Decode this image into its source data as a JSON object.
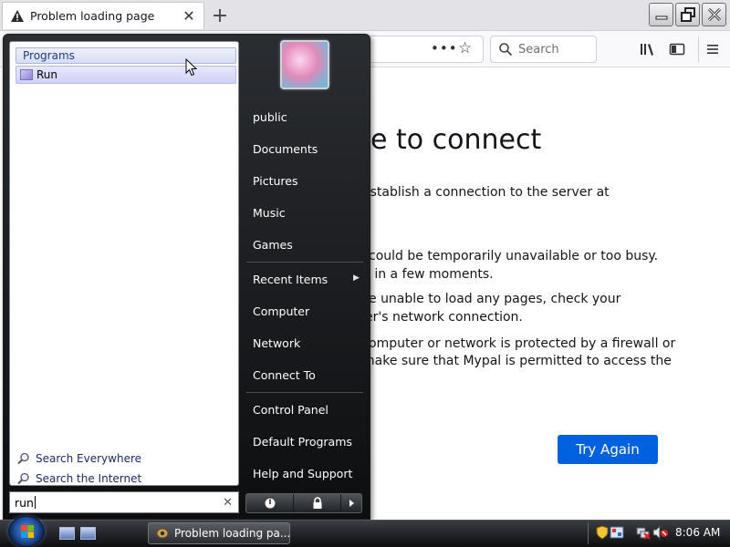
{
  "browser": {
    "tab_title": "Problem loading page",
    "search_placeholder": "Search",
    "error": {
      "title": "e to connect",
      "line1": "establish a connection to the server at",
      "bullet1a": "could be temporarily unavailable or too busy.",
      "bullet1b": "n in a few moments.",
      "bullet2a": "e unable to load any pages, check your",
      "bullet2b": "er's network connection.",
      "bullet3a": "omputer or network is protected by a firewall or",
      "bullet3b": "make sure that Mypal is permitted to access the"
    },
    "try_again_label": "Try Again"
  },
  "start_menu": {
    "programs_label": "Programs",
    "run_item_label": "Run",
    "search_everywhere_label": "Search Everywhere",
    "search_internet_label": "Search the Internet",
    "search_value": "run",
    "right_items": [
      "public",
      "Documents",
      "Pictures",
      "Music",
      "Games",
      "Recent Items",
      "Computer",
      "Network",
      "Connect To",
      "Control Panel",
      "Default Programs",
      "Help and Support"
    ]
  },
  "taskbar": {
    "window_button_label": "Problem loading pa...",
    "clock": "8:06 AM"
  },
  "colors": {
    "accent_button": "#0061e0",
    "start_menu_bg": "#1b1d20",
    "selection": "#cfd2f6"
  }
}
